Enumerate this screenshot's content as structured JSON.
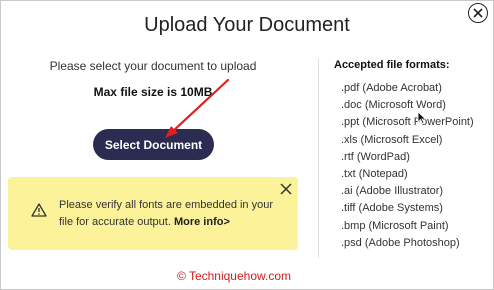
{
  "dialog": {
    "title": "Upload Your Document",
    "instruction": "Please select your document to upload",
    "max_size": "Max file size is 10MB",
    "select_button": "Select Document",
    "close_icon": "close-circle-icon"
  },
  "warning": {
    "text": "Please verify all fonts are embedded in your file for accurate output.",
    "more_link": "More info>",
    "icon": "warning-triangle-icon",
    "background_color": "#fbf29a"
  },
  "formats": {
    "title": "Accepted file formats:",
    "items": [
      ".pdf (Adobe Acrobat)",
      ".doc (Microsoft Word)",
      ".ppt (Microsoft PowerPoint)",
      ".xls (Microsoft Excel)",
      ".rtf (WordPad)",
      ".txt (Notepad)",
      ".ai (Adobe Illustrator)",
      ".tiff (Adobe Systems)",
      ".bmp (Microsoft Paint)",
      ".psd (Adobe Photoshop)"
    ]
  },
  "credit": "© Techniquehow.com",
  "colors": {
    "button": "#2c2c52",
    "annotation_arrow": "#e02020"
  }
}
